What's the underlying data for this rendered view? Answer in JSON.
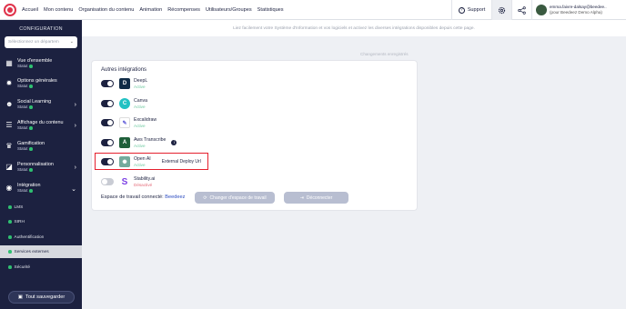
{
  "topnav": {
    "items": [
      "Accueil",
      "Mon contenu",
      "Organisation du contenu",
      "Animation",
      "Récompenses",
      "Utilisateurs/Groupes",
      "Statistiques"
    ],
    "support_label": "Support",
    "user_email": "emma.faivre-dalsay@beedee..",
    "user_sub": "(pour Beedeez Demo Alpha)"
  },
  "sidebar": {
    "title": "CONFIGURATION",
    "department_placeholder": "Sélectionnez un départem",
    "status_label": "Statut",
    "items": [
      {
        "label": "Vue d'ensemble",
        "icon": "grid-icon"
      },
      {
        "label": "Options générales",
        "icon": "gear-icon"
      },
      {
        "label": "Social Learning",
        "icon": "social-icon"
      },
      {
        "label": "Affichage du contenu",
        "icon": "list-icon"
      },
      {
        "label": "Gamification",
        "icon": "trophy-icon"
      },
      {
        "label": "Personnalisation",
        "icon": "customize-icon"
      },
      {
        "label": "Intégration",
        "icon": "integration-icon"
      }
    ],
    "subitems": [
      "LMS",
      "SIRH",
      "Authentification",
      "Services externes",
      "Sécurité"
    ],
    "save_label": "Tout sauvegarder"
  },
  "main": {
    "info_text": "Liez facilement votre Système d'Information et vos logiciels et activez les diverses intégrations disponibles depuis cette page.",
    "saved_note": "Changements enregistrés",
    "panel_title": "Autres intégrations",
    "integrations": [
      {
        "name": "DeepL",
        "status": "Active",
        "on": true,
        "color": "#0f2b46",
        "glyph": "D"
      },
      {
        "name": "Canva",
        "status": "Active",
        "on": true,
        "color": "#22c1c3",
        "glyph": "C"
      },
      {
        "name": "Excalidraw",
        "status": "Active",
        "on": true,
        "color": "#ffffff",
        "glyph": "✎"
      },
      {
        "name": "Aws Transcribe",
        "status": "Active",
        "on": true,
        "color": "#1f5f3a",
        "glyph": "A"
      },
      {
        "name": "Open AI",
        "status": "Active",
        "on": true,
        "color": "#74aa9c",
        "glyph": "✺",
        "extra": "External Deploy Url"
      },
      {
        "name": "Stability.ai",
        "status": "Désactivé",
        "on": false,
        "color": "#ffffff",
        "glyph": "S"
      }
    ],
    "workspace_label": "Espace de travail connecté:",
    "workspace_name": "Beedeez",
    "change_button": "Changer d'espace de travail",
    "disconnect_button": "Déconnecter"
  }
}
